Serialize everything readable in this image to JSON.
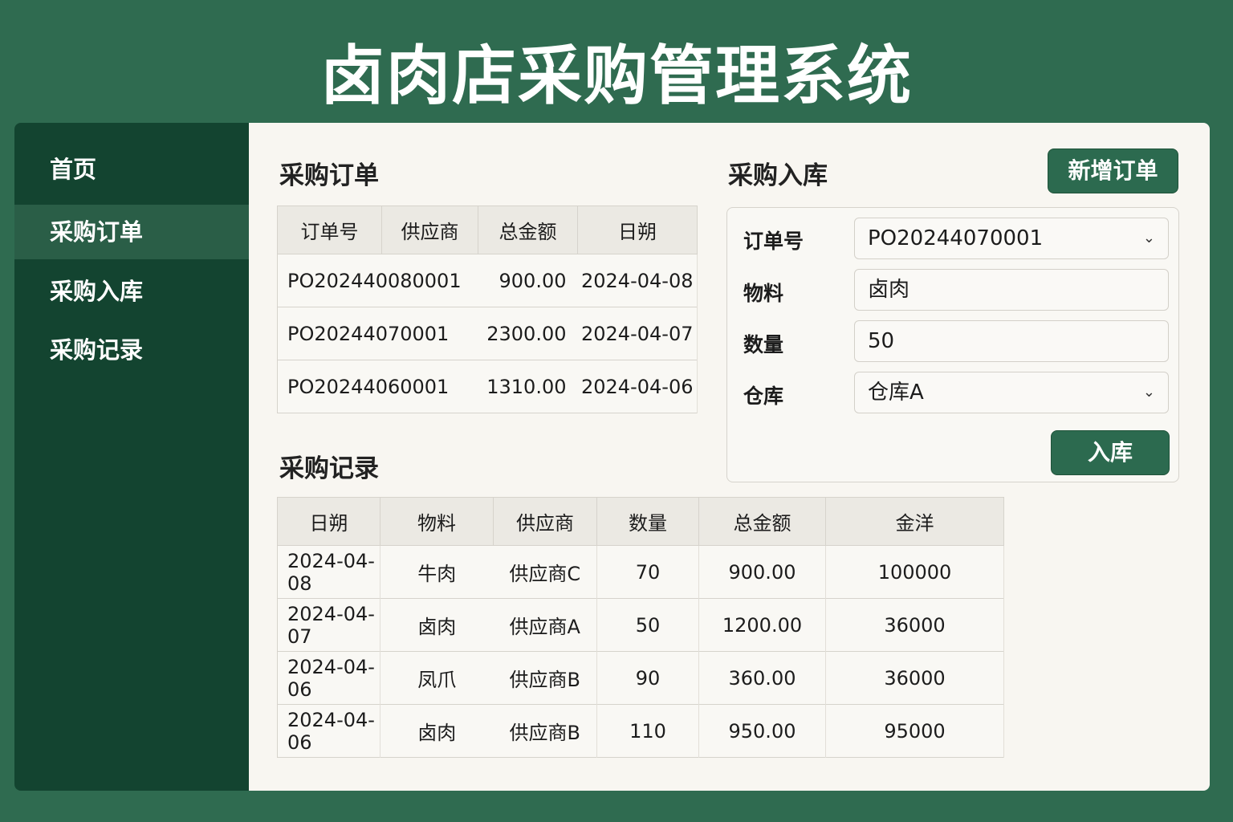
{
  "app_title": "卤肉店采购管理系统",
  "sidebar": {
    "items": [
      {
        "label": "首页"
      },
      {
        "label": "采购订单"
      },
      {
        "label": "采购入库"
      },
      {
        "label": "采购记录"
      }
    ]
  },
  "orders": {
    "title": "采购订单",
    "headers": [
      "订单号",
      "供应商",
      "总金额",
      "日朔"
    ],
    "rows": [
      [
        "PO202440080001",
        "",
        "900.00",
        "2024-04-08"
      ],
      [
        "PO20244070001",
        "",
        "2300.00",
        "2024-04-07"
      ],
      [
        "PO20244060001",
        "",
        "1310.00",
        "2024-04-06"
      ]
    ]
  },
  "inbound": {
    "title": "采购入库",
    "new_order_label": "新增订单",
    "order_label": "订单号",
    "order_value": "PO20244070001",
    "material_label": "物料",
    "material_value": "卤肉",
    "qty_label": "数量",
    "qty_value": "50",
    "warehouse_label": "仓库",
    "warehouse_value": "仓库A",
    "submit_label": "入库"
  },
  "records": {
    "title": "采购记录",
    "headers": [
      "日朔",
      "物料",
      "供应商",
      "数量",
      "总金额",
      "金洋"
    ],
    "rows": [
      [
        "2024-04-08",
        "牛肉",
        "供应商C",
        "70",
        "900.00",
        "100000"
      ],
      [
        "2024-04-07",
        "卤肉",
        "供应商A",
        "50",
        "1200.00",
        "36000"
      ],
      [
        "2024-04-06",
        "凤爪",
        "供应商B",
        "90",
        "360.00",
        "36000"
      ],
      [
        "2024-04-06",
        "卤肉",
        "供应商B",
        "110",
        "950.00",
        "95000"
      ]
    ]
  }
}
